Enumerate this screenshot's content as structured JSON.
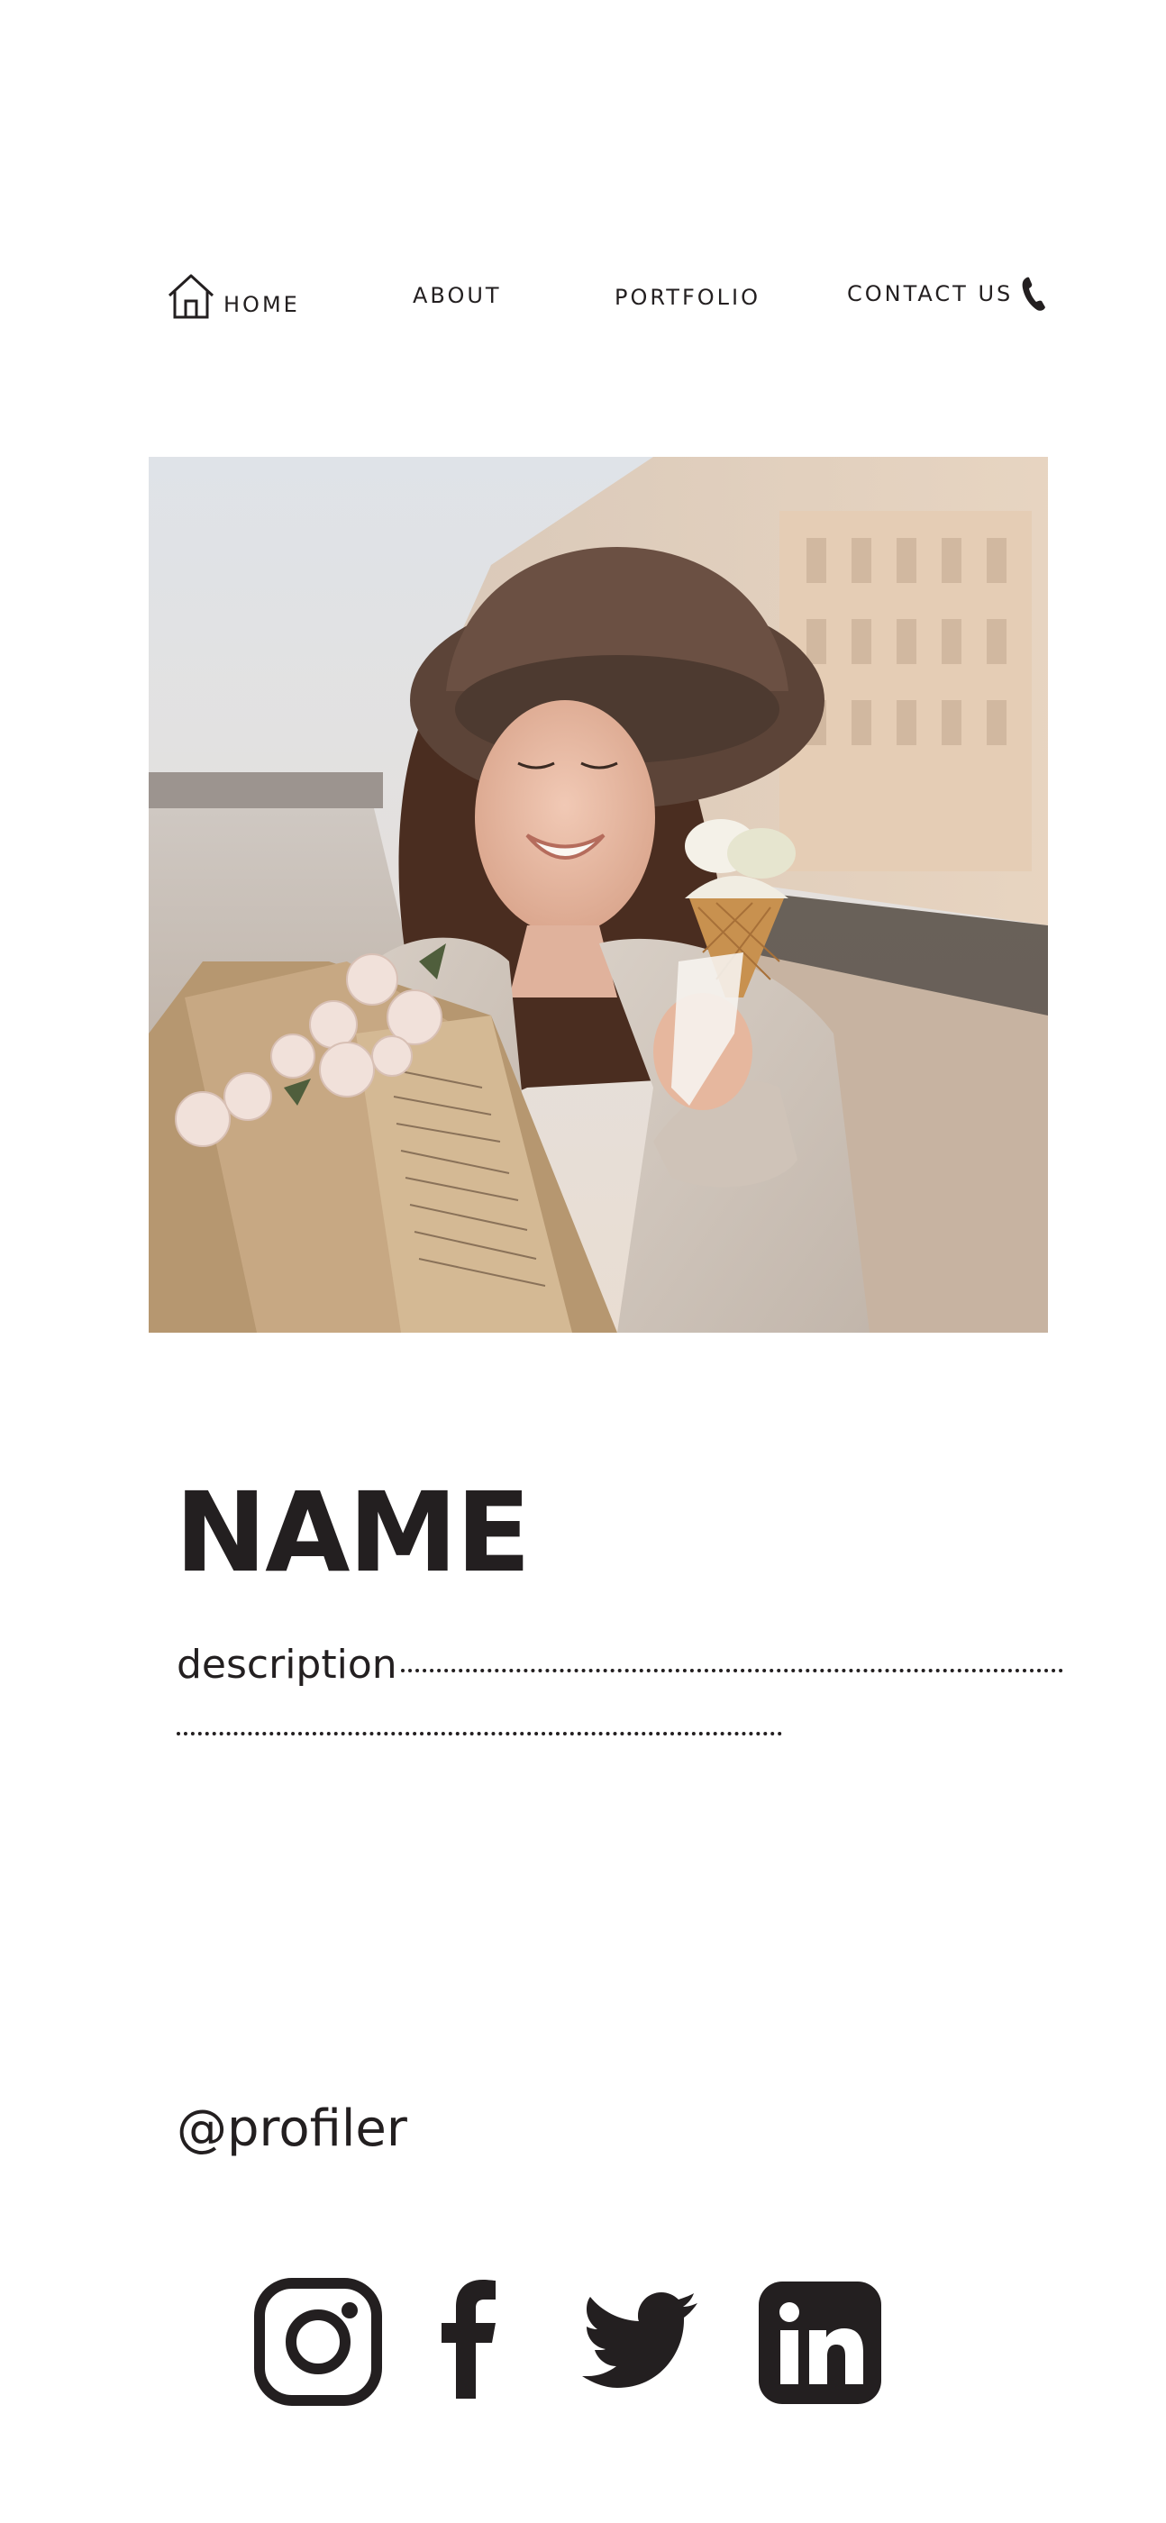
{
  "nav": {
    "items": [
      {
        "label": "HOME",
        "icon": "home-icon"
      },
      {
        "label": "ABOUT"
      },
      {
        "label": "PORTFOLIO"
      },
      {
        "label": "CONTACT US",
        "icon": "phone-icon"
      }
    ]
  },
  "hero": {
    "image": "photo-woman-hat-ice-cream-flowers"
  },
  "profile": {
    "name": "NAME",
    "description": "description",
    "handle": "@profiler"
  },
  "social": {
    "icons": [
      "instagram-icon",
      "facebook-icon",
      "twitter-icon",
      "linkedin-icon"
    ]
  },
  "colors": {
    "text": "#231f20",
    "background": "#ffffff"
  }
}
